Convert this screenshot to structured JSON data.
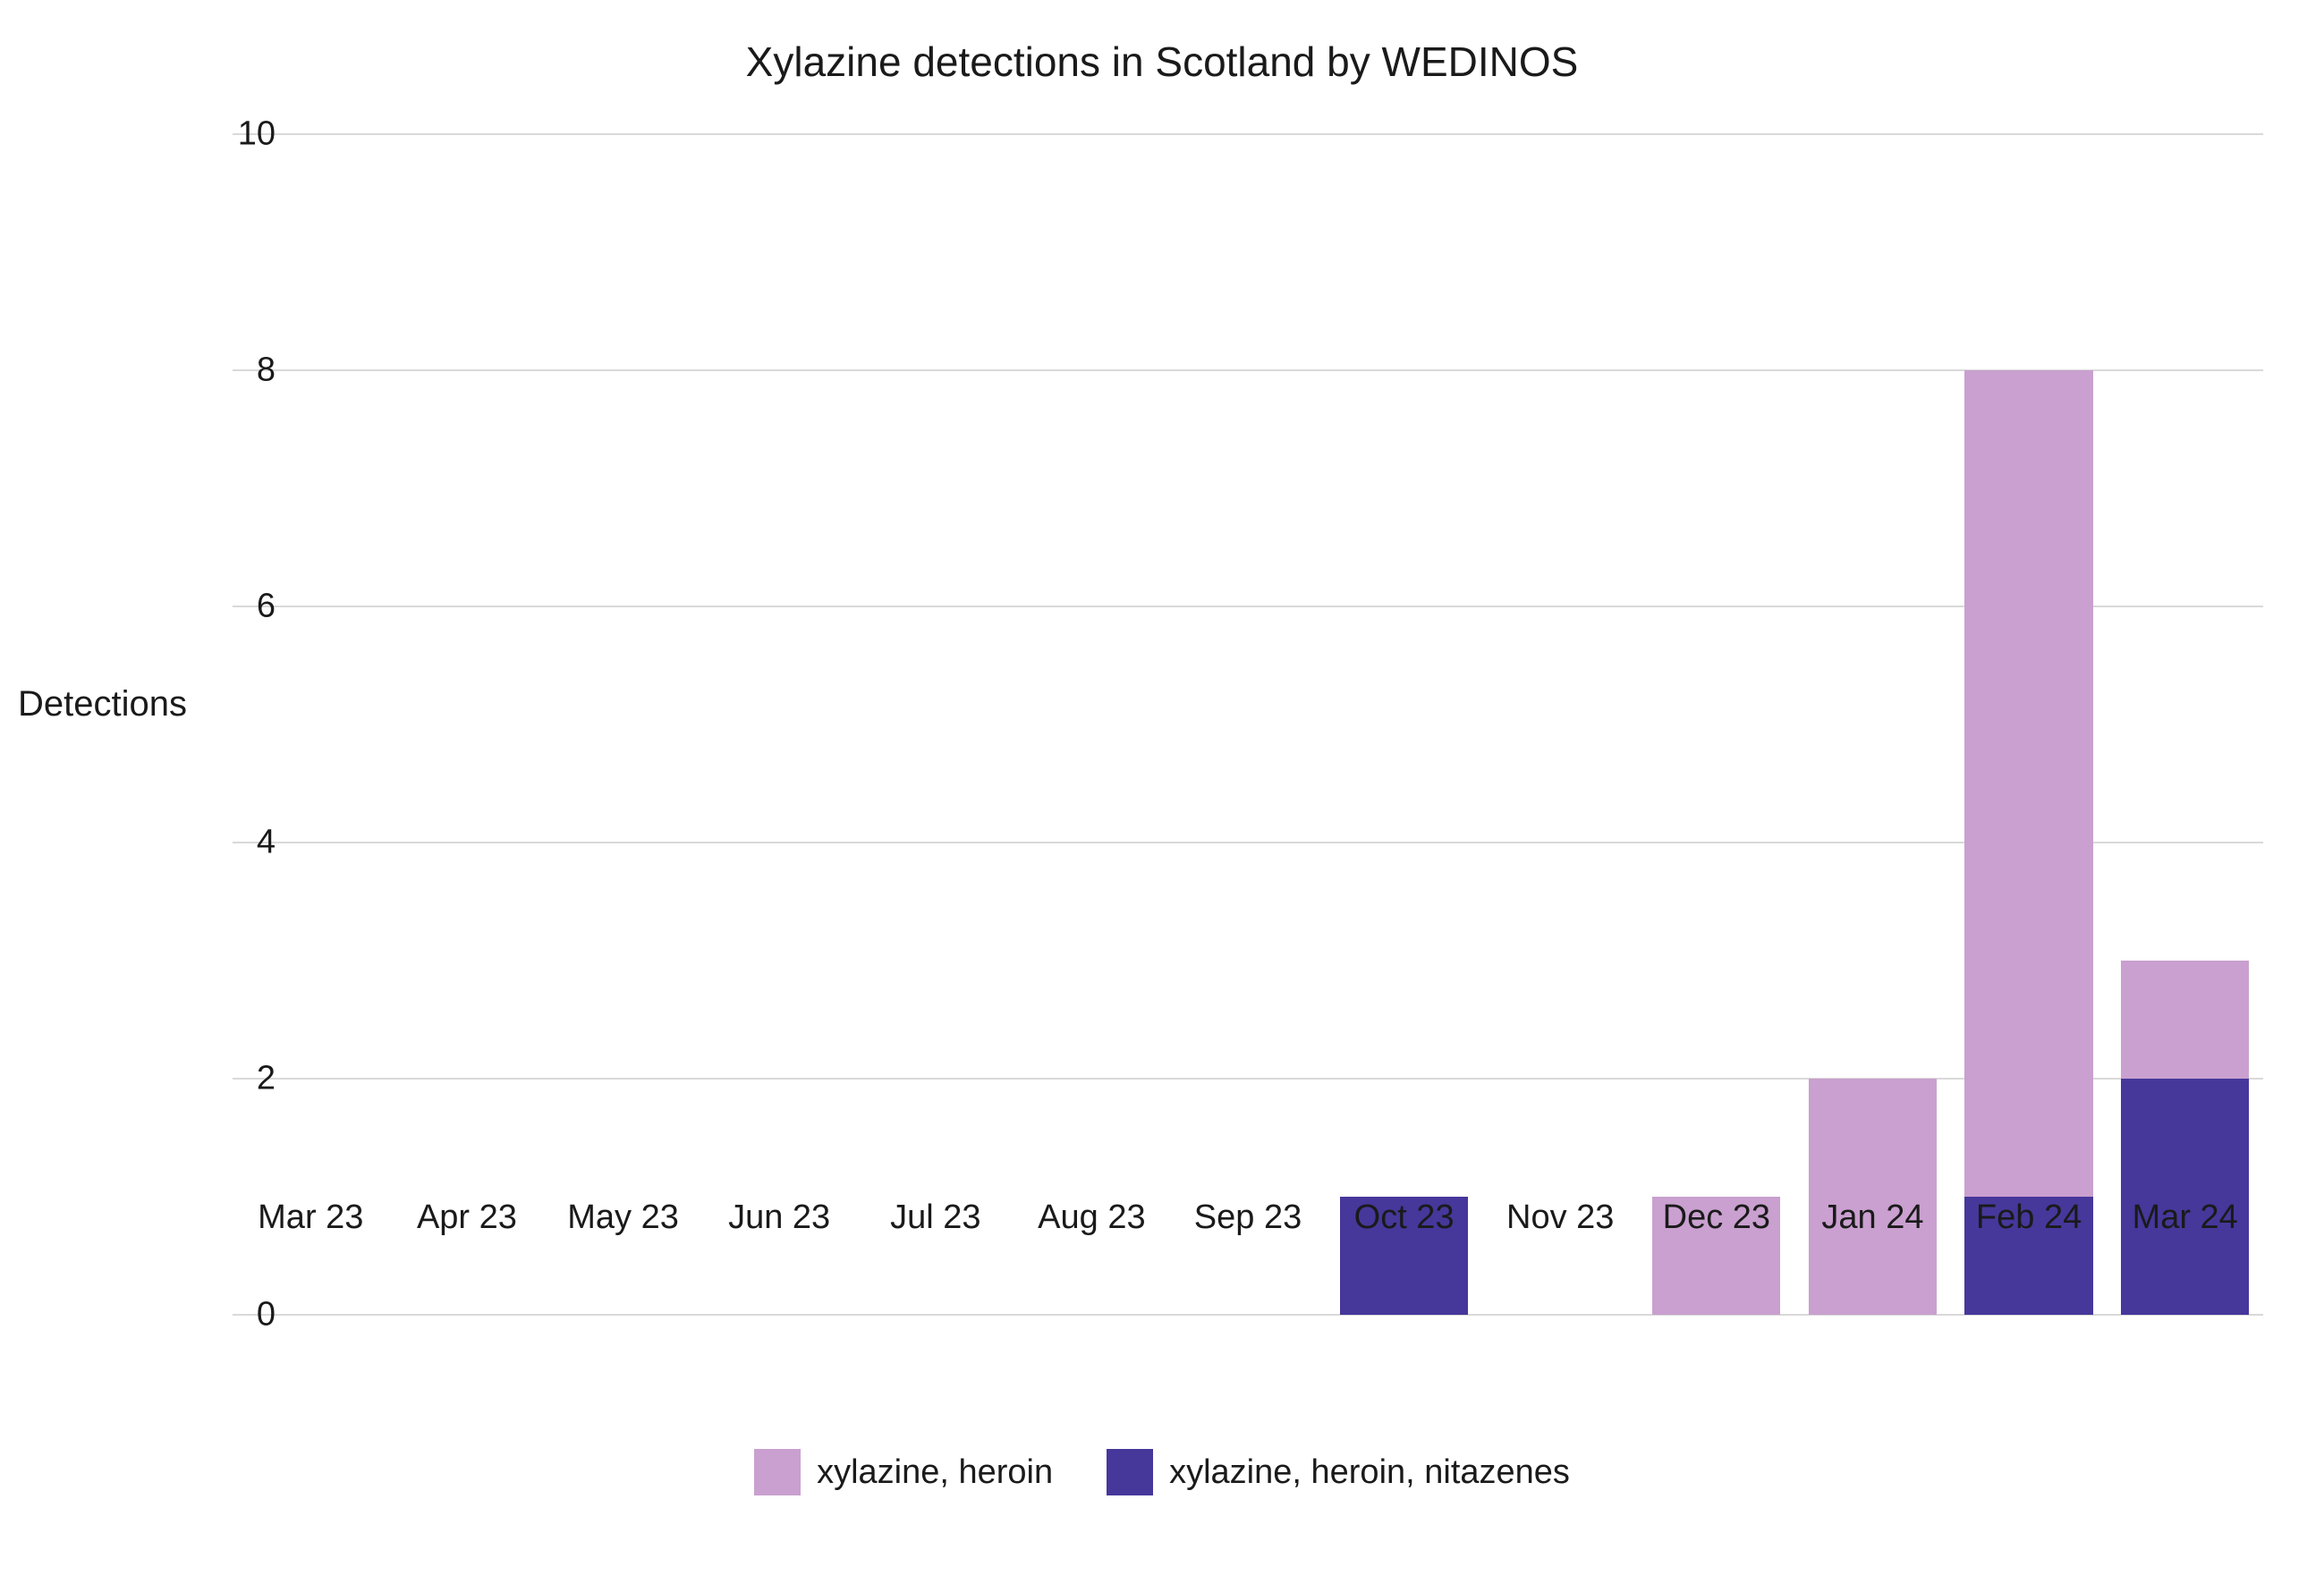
{
  "chart_data": {
    "type": "bar",
    "title": "Xylazine detections in Scotland by WEDINOS",
    "ylabel": "Detections",
    "xlabel": "",
    "ylim": [
      0,
      10
    ],
    "yticks": [
      0,
      2,
      4,
      6,
      8,
      10
    ],
    "categories": [
      "Mar 23",
      "Apr 23",
      "May 23",
      "Jun 23",
      "Jul 23",
      "Aug 23",
      "Sep 23",
      "Oct 23",
      "Nov 23",
      "Dec 23",
      "Jan 24",
      "Feb 24",
      "Mar 24"
    ],
    "series": [
      {
        "name": "xylazine, heroin",
        "color": "#c9a0cf",
        "values": [
          0,
          0,
          0,
          0,
          0,
          0,
          0,
          0,
          0,
          1,
          2,
          7,
          1
        ]
      },
      {
        "name": "xylazine, heroin, nitazenes",
        "color": "#46379b",
        "values": [
          0,
          0,
          0,
          0,
          0,
          0,
          0,
          1,
          0,
          0,
          0,
          1,
          2
        ]
      }
    ],
    "legend_position": "bottom",
    "stacked": true
  }
}
